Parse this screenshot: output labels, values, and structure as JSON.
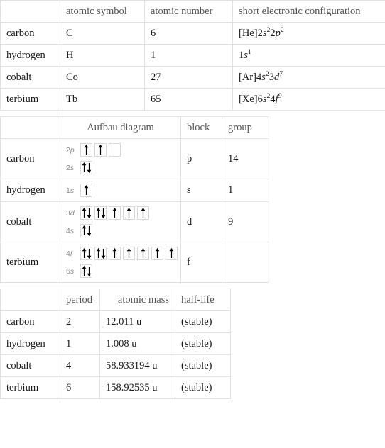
{
  "table_element_properties": {
    "row_labels": [
      "carbon",
      "hydrogen",
      "cobalt",
      "terbium"
    ],
    "headers": [
      "",
      "atomic symbol",
      "atomic number",
      "short electronic configuration"
    ],
    "rows": [
      {
        "name": "carbon",
        "atomic_symbol": "C",
        "atomic_number": "6",
        "short_electronic_configuration": "[He]2s^2 2p^2",
        "config_parts": [
          {
            "t": "[He]2",
            "i": false,
            "sup": ""
          },
          {
            "t": "s",
            "i": true,
            "sup": "2"
          },
          {
            "t": "2",
            "i": false,
            "sup": ""
          },
          {
            "t": "p",
            "i": true,
            "sup": "2"
          }
        ]
      },
      {
        "name": "hydrogen",
        "atomic_symbol": "H",
        "atomic_number": "1",
        "short_electronic_configuration": "1s^1",
        "config_parts": [
          {
            "t": "1",
            "i": false,
            "sup": ""
          },
          {
            "t": "s",
            "i": true,
            "sup": "1"
          }
        ]
      },
      {
        "name": "cobalt",
        "atomic_symbol": "Co",
        "atomic_number": "27",
        "short_electronic_configuration": "[Ar]4s^2 3d^7",
        "config_parts": [
          {
            "t": "[Ar]4",
            "i": false,
            "sup": ""
          },
          {
            "t": "s",
            "i": true,
            "sup": "2"
          },
          {
            "t": "3",
            "i": false,
            "sup": ""
          },
          {
            "t": "d",
            "i": true,
            "sup": "7"
          }
        ]
      },
      {
        "name": "terbium",
        "atomic_symbol": "Tb",
        "atomic_number": "65",
        "short_electronic_configuration": "[Xe]6s^2 4f^9",
        "config_parts": [
          {
            "t": "[Xe]6",
            "i": false,
            "sup": ""
          },
          {
            "t": "s",
            "i": true,
            "sup": "2"
          },
          {
            "t": "4",
            "i": false,
            "sup": ""
          },
          {
            "t": "f",
            "i": true,
            "sup": "9"
          }
        ]
      }
    ]
  },
  "table_aufbau": {
    "headers": [
      "",
      "Aufbau diagram",
      "block",
      "group"
    ],
    "rows": [
      {
        "name": "carbon",
        "block": "p",
        "group": "14",
        "shells": [
          {
            "n": "2",
            "orbital": "p",
            "boxes": [
              "up",
              "up",
              "empty"
            ]
          },
          {
            "n": "2",
            "orbital": "s",
            "boxes": [
              "updown"
            ]
          }
        ]
      },
      {
        "name": "hydrogen",
        "block": "s",
        "group": "1",
        "shells": [
          {
            "n": "1",
            "orbital": "s",
            "boxes": [
              "up"
            ]
          }
        ]
      },
      {
        "name": "cobalt",
        "block": "d",
        "group": "9",
        "shells": [
          {
            "n": "3",
            "orbital": "d",
            "boxes": [
              "updown",
              "updown",
              "up",
              "up",
              "up"
            ]
          },
          {
            "n": "4",
            "orbital": "s",
            "boxes": [
              "updown"
            ]
          }
        ]
      },
      {
        "name": "terbium",
        "block": "f",
        "group": "",
        "shells": [
          {
            "n": "4",
            "orbital": "f",
            "boxes": [
              "updown",
              "updown",
              "up",
              "up",
              "up",
              "up",
              "up"
            ]
          },
          {
            "n": "6",
            "orbital": "s",
            "boxes": [
              "updown"
            ]
          }
        ]
      }
    ]
  },
  "table_nuclear": {
    "headers": [
      "",
      "period",
      "atomic mass",
      "half-life"
    ],
    "rows": [
      {
        "name": "carbon",
        "period": "2",
        "atomic_mass": "12.011 u",
        "half_life": "(stable)"
      },
      {
        "name": "hydrogen",
        "period": "1",
        "atomic_mass": "1.008 u",
        "half_life": "(stable)"
      },
      {
        "name": "cobalt",
        "period": "4",
        "atomic_mass": "58.933194 u",
        "half_life": "(stable)"
      },
      {
        "name": "terbium",
        "period": "6",
        "atomic_mass": "158.92535 u",
        "half_life": "(stable)"
      }
    ]
  },
  "colors": {
    "border": "#e2e2e2",
    "header_text": "#555555",
    "row_label_text": "#636363",
    "value_text": "#1c1c1c",
    "muted_text": "#b0b0b0",
    "orbital_box_border": "#d9d9d9",
    "arrow": "#000000"
  }
}
